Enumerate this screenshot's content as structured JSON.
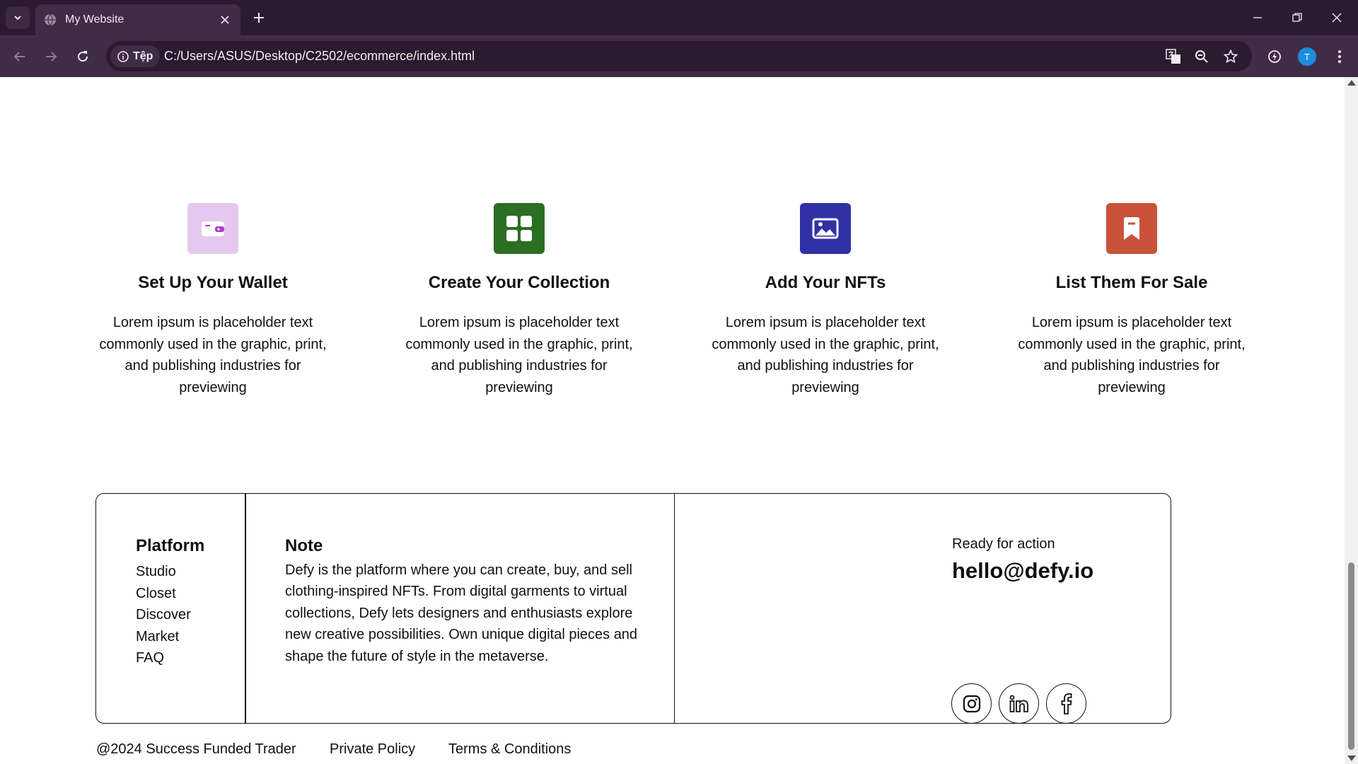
{
  "browser": {
    "tab_title": "My Website",
    "site_chip": "Tệp",
    "url": "C:/Users/ASUS/Desktop/C2502/ecommerce/index.html",
    "profile_initial": "T"
  },
  "features": [
    {
      "title": "Set Up Your Wallet",
      "text": "Lorem ipsum is placeholder text commonly used in the graphic, print, and publishing industries for previewing",
      "icon": "wallet-icon",
      "color": "#e6c8ee"
    },
    {
      "title": "Create Your Collection",
      "text": "Lorem ipsum is placeholder text commonly used in the graphic, print, and publishing industries for previewing",
      "icon": "grid-icon",
      "color": "#2c6e23"
    },
    {
      "title": "Add Your NFTs",
      "text": "Lorem ipsum is placeholder text commonly used in the graphic, print, and publishing industries for previewing",
      "icon": "image-icon",
      "color": "#3131a6"
    },
    {
      "title": "List Them For Sale",
      "text": "Lorem ipsum is placeholder text commonly used in the graphic, print, and publishing industries for previewing",
      "icon": "bookmark-icon",
      "color": "#c9523b"
    }
  ],
  "footer": {
    "platform_title": "Platform",
    "platform_links": [
      "Studio",
      "Closet",
      "Discover",
      "Market",
      "FAQ"
    ],
    "note_title": "Note",
    "note_text": "Defy is the platform where you can create, buy, and sell clothing-inspired NFTs. From digital garments to virtual collections, Defy lets designers and enthusiasts explore new creative possibilities. Own unique digital pieces and shape the future of style in the metaverse.",
    "ready_text": "Ready for action",
    "email": "hello@defy.io",
    "socials": [
      "instagram-icon",
      "linkedin-icon",
      "facebook-icon"
    ]
  },
  "bottom": {
    "copyright": "@2024 Success Funded Trader",
    "privacy": "Private Policy",
    "terms": "Terms & Conditions"
  }
}
